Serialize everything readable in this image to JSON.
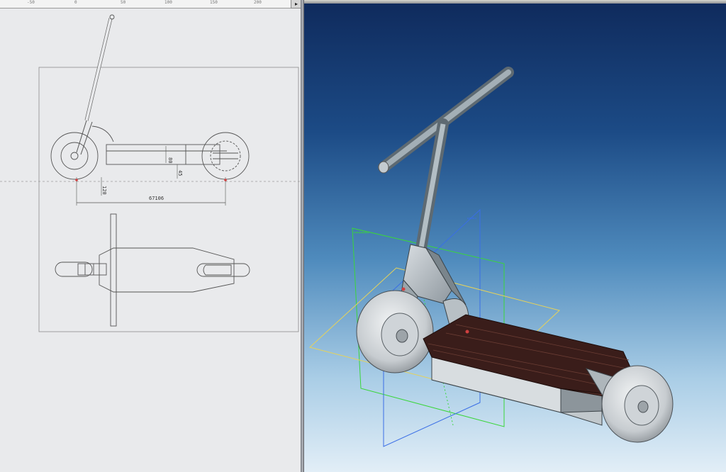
{
  "ruler": {
    "ticks": [
      "-50",
      "0",
      "50",
      "100",
      "150",
      "200"
    ],
    "scroll_arrow": "▸"
  },
  "drawing": {
    "dim_height_1": "80",
    "dim_height_2": "45",
    "dim_ground": "120",
    "dim_length": "67106"
  },
  "colors": {
    "drawing_background": "#e9eaec",
    "viewport_top": "#0f2a5c",
    "viewport_bottom": "#e2eef7",
    "deck": "#3a1d1a",
    "plane_front": "#3ad63a",
    "plane_right": "#3a6ee6",
    "plane_top": "#e6d25a"
  }
}
